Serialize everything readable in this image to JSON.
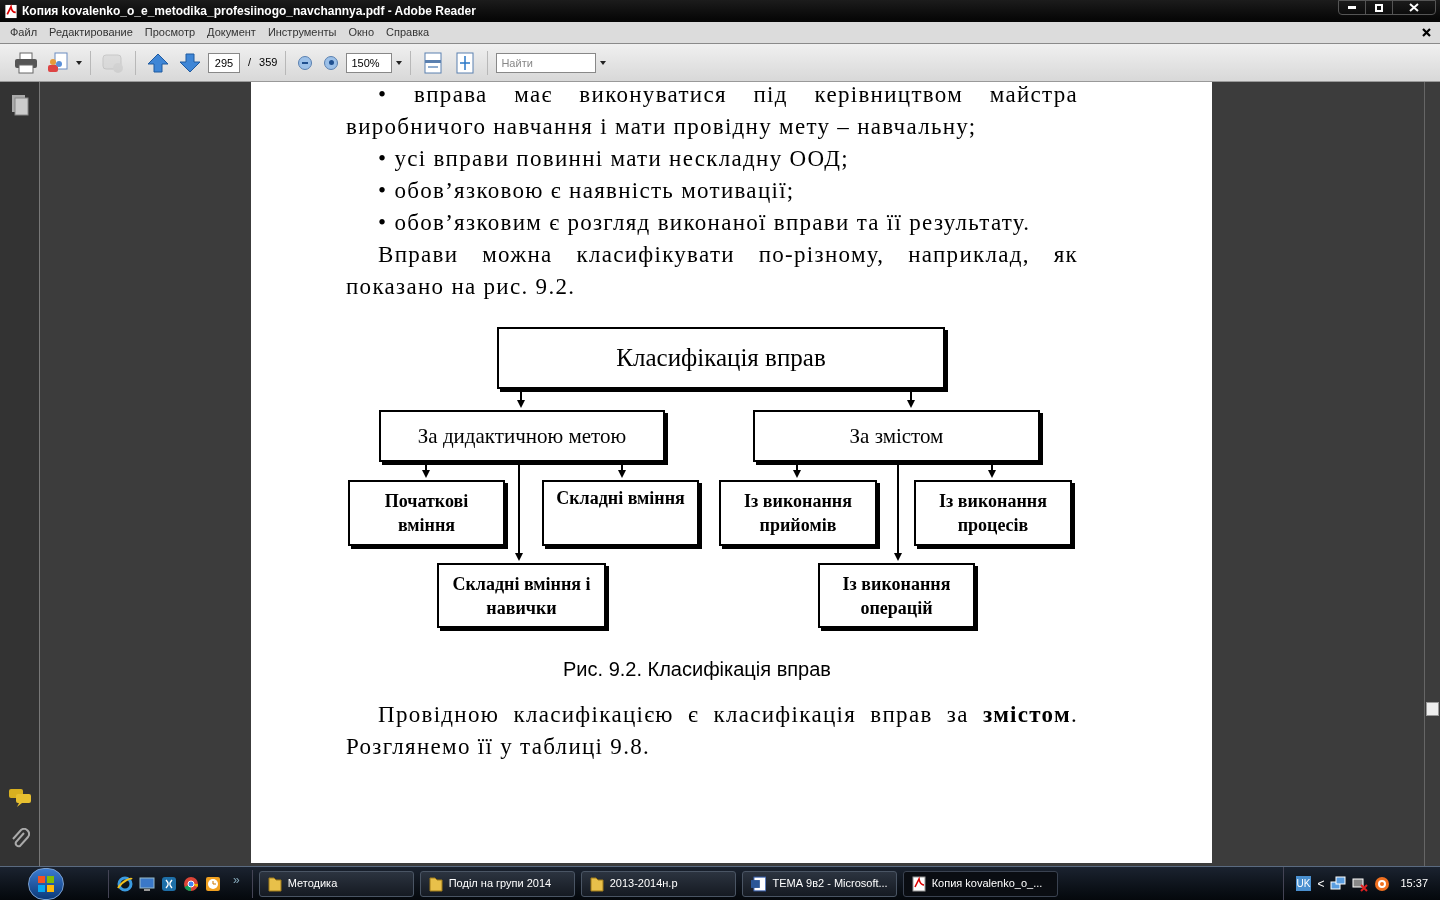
{
  "window": {
    "title": "Копия kovalenko_o_e_metodika_profesiinogo_navchannya.pdf - Adobe Reader"
  },
  "menu": [
    "Файл",
    "Редактирование",
    "Просмотр",
    "Документ",
    "Инструменты",
    "Окно",
    "Справка"
  ],
  "toolbar": {
    "page": "295",
    "page_sep": "/",
    "page_count": "359",
    "zoom": "150%",
    "search": {
      "placeholder": "Найти"
    },
    "comment_disabled": true
  },
  "document": {
    "paragraphs": [
      {
        "text": "• вправа має виконуватися під керівництвом майстра виробничого навчання і мати провідну мету – навчальну;"
      },
      {
        "text": "• усі вправи повинні мати нескладну ООД;"
      },
      {
        "text": "• обов’язковою є наявність мотивації;"
      },
      {
        "text": "• обов’язковим є розгляд виконаної вправи та її результату."
      },
      {
        "text": "Вправи можна класифікувати по-різному, наприклад, як показано на рис. 9.2."
      }
    ],
    "diagram": {
      "root": {
        "text": "Класифікація вправ",
        "children": [
          {
            "text": "За дидактичною метою",
            "children": [
              {
                "text": "Початкові вміння"
              },
              {
                "text": "Складні вміння"
              },
              {
                "text": "Складні вміння і навички"
              }
            ]
          },
          {
            "text": "За змістом",
            "children": [
              {
                "text": "Із виконання прийомів"
              },
              {
                "text": "Із виконання процесів"
              },
              {
                "text": "Із виконання операцій"
              }
            ]
          }
        ]
      }
    },
    "caption": "Рис. 9.2. Класифікація вправ",
    "closing": "Провідною класифікацією є класифікація вправ за **змістом**. Розглянемо її у таблиці 9.8."
  },
  "taskbar": {
    "more": "»",
    "tasks": [
      {
        "label": "Методика",
        "kind": "folder",
        "selected": false
      },
      {
        "label": "Поділ на групи 2014",
        "kind": "folder",
        "selected": false
      },
      {
        "label": "2013-2014н.р",
        "kind": "folder",
        "selected": false
      },
      {
        "label": "ТЕМА 9в2 - Microsoft...",
        "kind": "word",
        "selected": false
      },
      {
        "label": "Копия kovalenko_o_...",
        "kind": "pdf",
        "selected": true
      }
    ],
    "tray": {
      "language": "UK",
      "expand": "<",
      "clock": "15:37"
    }
  }
}
